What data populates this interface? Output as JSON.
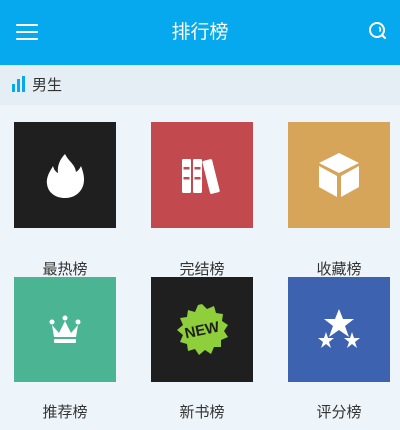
{
  "header": {
    "title": "排行榜",
    "menu_icon": "menu-icon",
    "search_icon": "search-icon",
    "background": "#06a9ee"
  },
  "section": {
    "label": "男生",
    "icon": "bar-chart-icon"
  },
  "categories": [
    {
      "label": "最热榜",
      "icon": "flame-icon",
      "color": "#1f1f1f"
    },
    {
      "label": "完结榜",
      "icon": "books-icon",
      "color": "#c24a4f"
    },
    {
      "label": "收藏榜",
      "icon": "box-icon",
      "color": "#d6a55a"
    },
    {
      "label": "推荐榜",
      "icon": "crown-icon",
      "color": "#4bb593"
    },
    {
      "label": "新书榜",
      "icon": "new-badge-icon",
      "color": "#1f1f1f",
      "badge_text": "NEW"
    },
    {
      "label": "评分榜",
      "icon": "stars-icon",
      "color": "#3d63b0"
    }
  ]
}
